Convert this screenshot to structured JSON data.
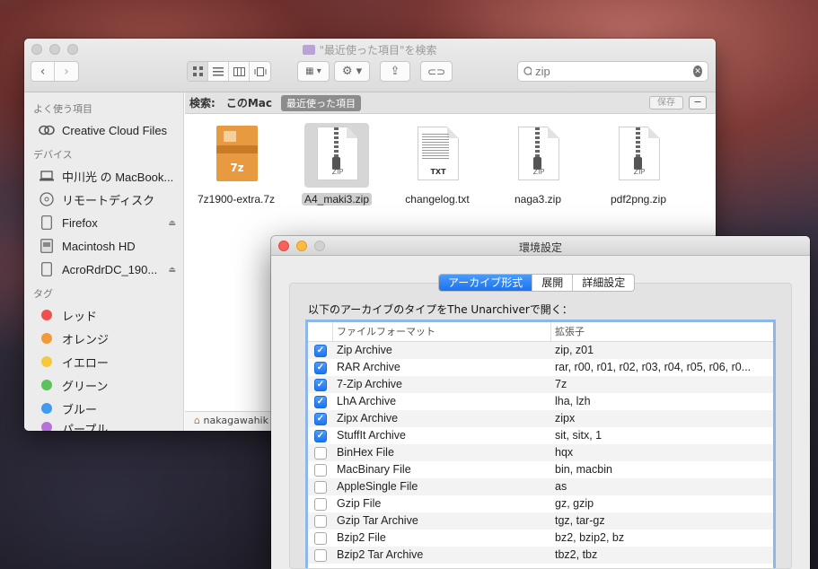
{
  "finder": {
    "title": "\"最近使った項目\"を検索",
    "search_value": "zip",
    "scope_label": "検索:",
    "scope_options": [
      "このMac",
      "最近使った項目"
    ],
    "save_label": "保存",
    "minus_label": "−",
    "path_bar": "nakagawahik",
    "sidebar": {
      "favorites_head": "よく使う項目",
      "favorites": [
        {
          "label": "Creative Cloud Files",
          "icon": "creative-cloud-icon"
        }
      ],
      "devices_head": "デバイス",
      "devices": [
        {
          "label": "中川光 の MacBook...",
          "icon": "laptop-icon"
        },
        {
          "label": "リモートディスク",
          "icon": "disc-icon"
        },
        {
          "label": "Firefox",
          "icon": "disk-icon",
          "eject": true
        },
        {
          "label": "Macintosh HD",
          "icon": "hard-drive-icon"
        },
        {
          "label": "AcroRdrDC_190...",
          "icon": "disk-icon",
          "eject": true
        }
      ],
      "tags_head": "タグ",
      "tags": [
        {
          "label": "レッド",
          "color": "#f0504c"
        },
        {
          "label": "オレンジ",
          "color": "#f29a38"
        },
        {
          "label": "イエロー",
          "color": "#f4c93b"
        },
        {
          "label": "グリーン",
          "color": "#5ac25a"
        },
        {
          "label": "ブルー",
          "color": "#3e9bf0"
        },
        {
          "label": "パープル",
          "color": "#b772d8"
        }
      ]
    },
    "files": [
      {
        "name": "7z1900-extra.7z",
        "kind": "7z",
        "label": "7z"
      },
      {
        "name": "A4_maki3.zip",
        "kind": "zip",
        "label": "ZIP",
        "selected": true
      },
      {
        "name": "changelog.txt",
        "kind": "txt",
        "label": "TXT"
      },
      {
        "name": "naga3.zip",
        "kind": "zip",
        "label": "ZIP"
      },
      {
        "name": "pdf2png.zip",
        "kind": "zip",
        "label": "ZIP"
      }
    ]
  },
  "prefs": {
    "title": "環境設定",
    "tabs": [
      "アーカイブ形式",
      "展開",
      "詳細設定"
    ],
    "active_tab": 0,
    "description": "以下のアーカイブのタイプをThe Unarchiverで開く：",
    "columns": [
      "ファイルフォーマット",
      "拡張子"
    ],
    "rows": [
      {
        "format": "Zip Archive",
        "ext": "zip, z01",
        "checked": true
      },
      {
        "format": "RAR Archive",
        "ext": "rar, r00, r01, r02, r03, r04, r05, r06, r0...",
        "checked": true
      },
      {
        "format": "7-Zip Archive",
        "ext": "7z",
        "checked": true
      },
      {
        "format": "LhA Archive",
        "ext": "lha, lzh",
        "checked": true
      },
      {
        "format": "Zipx Archive",
        "ext": "zipx",
        "checked": true
      },
      {
        "format": "StuffIt Archive",
        "ext": "sit, sitx, 1",
        "checked": true
      },
      {
        "format": "BinHex File",
        "ext": "hqx",
        "checked": false
      },
      {
        "format": "MacBinary File",
        "ext": "bin, macbin",
        "checked": false
      },
      {
        "format": "AppleSingle File",
        "ext": "as",
        "checked": false
      },
      {
        "format": "Gzip File",
        "ext": "gz, gzip",
        "checked": false
      },
      {
        "format": "Gzip Tar Archive",
        "ext": "tgz, tar-gz",
        "checked": false
      },
      {
        "format": "Bzip2 File",
        "ext": "bz2, bzip2, bz",
        "checked": false
      },
      {
        "format": "Bzip2 Tar Archive",
        "ext": "tbz2, tbz",
        "checked": false
      }
    ]
  }
}
